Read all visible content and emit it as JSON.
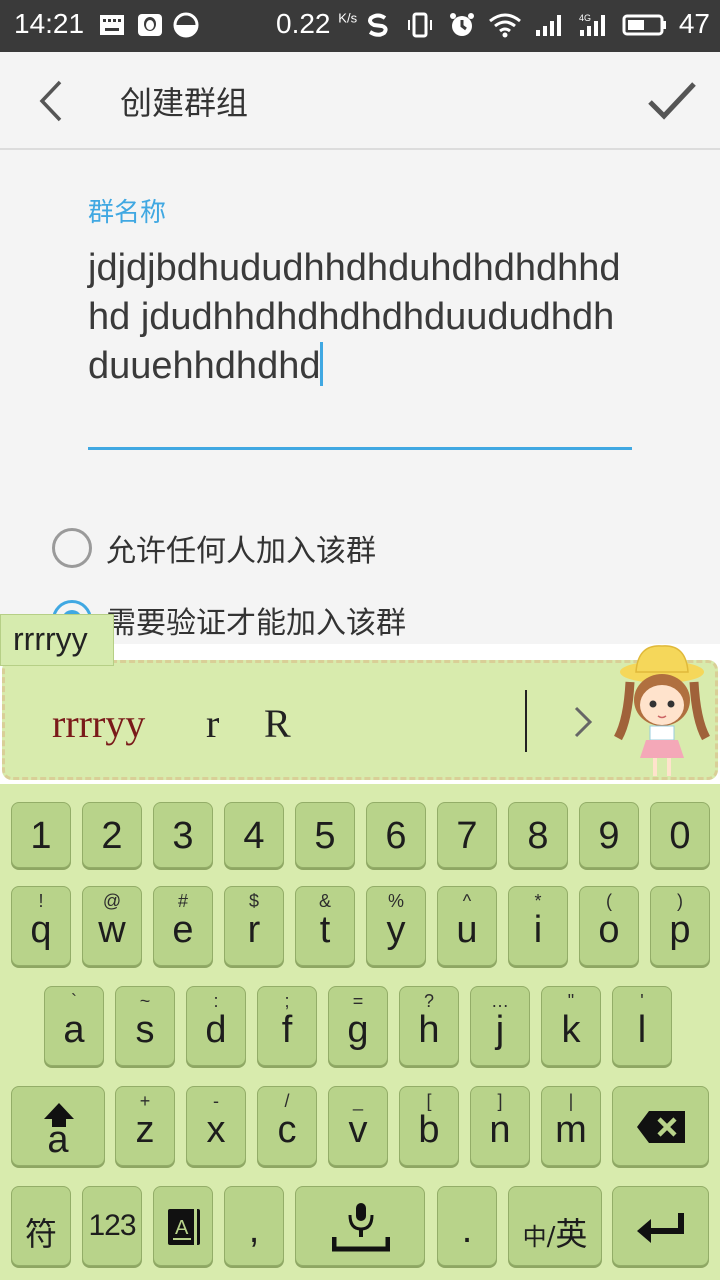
{
  "status_bar": {
    "time": "14:21",
    "network_speed": "0.22",
    "network_speed_unit": "K/s",
    "battery": "47"
  },
  "app_bar": {
    "title": "创建群组",
    "back_icon": "back-chevron-icon",
    "confirm_icon": "check-icon"
  },
  "form": {
    "name_label": "群名称",
    "name_value": "jdjdjbdhududhhdhduhdhdhdhhdhd jdudhhdhdhdhdhduududhdhduuehhdhdhd",
    "accent_color": "#40a8e2",
    "options": [
      {
        "label": "允许任何人加入该群",
        "checked": false
      },
      {
        "label": "需要验证才能加入该群",
        "checked": true
      }
    ]
  },
  "ime": {
    "composing_text": "rrrryy",
    "candidates": [
      "rrrryy",
      "r",
      "R"
    ],
    "more_icon": "chevron-right-icon",
    "keyboard_color": "#d8ebad",
    "key_color": "#b8d38a",
    "number_row": [
      "1",
      "2",
      "3",
      "4",
      "5",
      "6",
      "7",
      "8",
      "9",
      "0"
    ],
    "row1": [
      {
        "main": "q",
        "sub": "!"
      },
      {
        "main": "w",
        "sub": "@"
      },
      {
        "main": "e",
        "sub": "#"
      },
      {
        "main": "r",
        "sub": "$"
      },
      {
        "main": "t",
        "sub": "&"
      },
      {
        "main": "y",
        "sub": "%"
      },
      {
        "main": "u",
        "sub": "^"
      },
      {
        "main": "i",
        "sub": "*"
      },
      {
        "main": "o",
        "sub": "("
      },
      {
        "main": "p",
        "sub": ")"
      }
    ],
    "row2": [
      {
        "main": "a",
        "sub": "`"
      },
      {
        "main": "s",
        "sub": "~"
      },
      {
        "main": "d",
        "sub": ":"
      },
      {
        "main": "f",
        "sub": ";"
      },
      {
        "main": "g",
        "sub": "="
      },
      {
        "main": "h",
        "sub": "?"
      },
      {
        "main": "j",
        "sub": "…"
      },
      {
        "main": "k",
        "sub": "\""
      },
      {
        "main": "l",
        "sub": "'"
      }
    ],
    "row3": [
      {
        "main": "z",
        "sub": "+"
      },
      {
        "main": "x",
        "sub": "-"
      },
      {
        "main": "c",
        "sub": "/"
      },
      {
        "main": "v",
        "sub": "_"
      },
      {
        "main": "b",
        "sub": "["
      },
      {
        "main": "n",
        "sub": "]"
      },
      {
        "main": "m",
        "sub": "|"
      }
    ],
    "shift_letter": "a",
    "symbols_label": "符",
    "numbers_label": "123",
    "comma_label": ",",
    "period_label": ".",
    "lang_small": "中",
    "lang_sep": "/",
    "lang_big": "英"
  }
}
